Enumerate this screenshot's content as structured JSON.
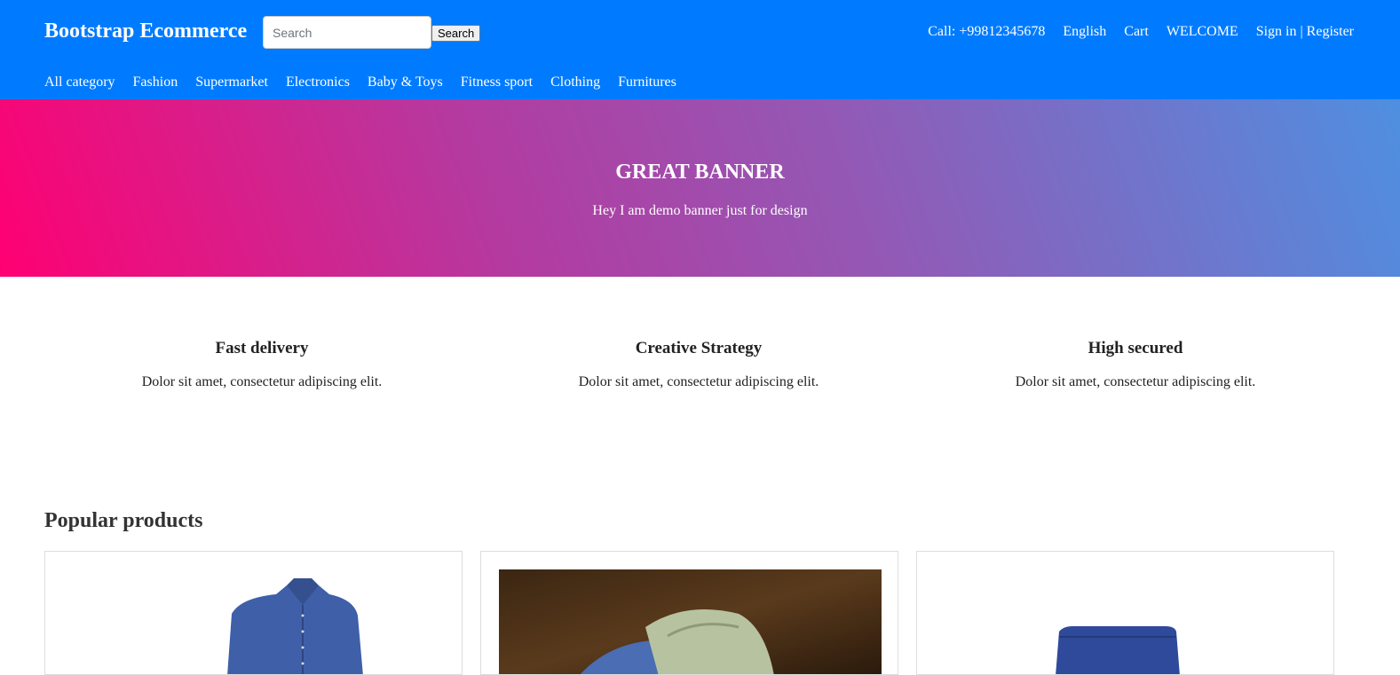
{
  "header": {
    "brand": "Bootstrap Ecommerce",
    "search": {
      "placeholder": "Search",
      "button_label": "Search"
    },
    "top_links": [
      "Call: +99812345678",
      "English",
      "Cart",
      "WELCOME",
      "Sign in | Register"
    ],
    "categories": [
      "All category",
      "Fashion",
      "Supermarket",
      "Electronics",
      "Baby & Toys",
      "Fitness sport",
      "Clothing",
      "Furnitures"
    ]
  },
  "banner": {
    "title": "GREAT BANNER",
    "subtitle": "Hey I am demo banner just for design"
  },
  "features": [
    {
      "title": "Fast delivery",
      "text": "Dolor sit amet, consectetur adipiscing elit."
    },
    {
      "title": "Creative Strategy",
      "text": "Dolor sit amet, consectetur adipiscing elit."
    },
    {
      "title": "High secured",
      "text": "Dolor sit amet, consectetur adipiscing elit."
    }
  ],
  "popular": {
    "title": "Popular products"
  },
  "colors": {
    "header_bg": "#007bff",
    "gradient_start": "#ff0072",
    "gradient_end": "#4f8fe0"
  }
}
